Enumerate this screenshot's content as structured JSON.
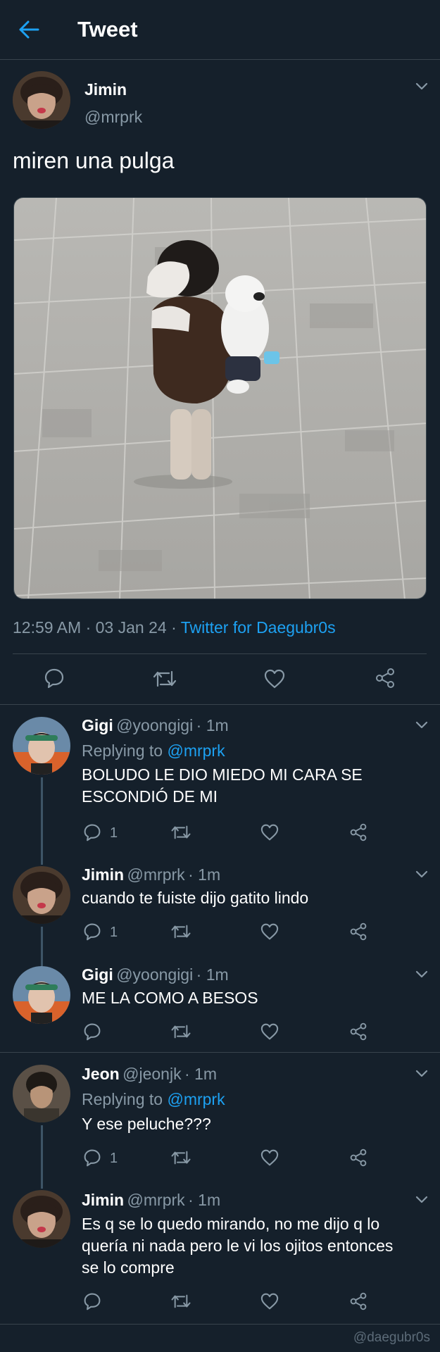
{
  "header": {
    "title": "Tweet"
  },
  "tweet": {
    "name": "Jimin",
    "handle": "@mrprk",
    "text": "miren una pulga",
    "time": "12:59 AM",
    "date": "03 Jan 24",
    "source": "Twitter for Daegubr0s",
    "sep": "·"
  },
  "replies": [
    {
      "name": "Gigi",
      "handle": "@yoongigi",
      "time": "· 1m",
      "replying_label": "Replying to",
      "replying_to": "@mrprk",
      "text_lines": [
        "BOLUDO LE DIO MIEDO MI CARA SE",
        "ESCONDIÓ DE MI"
      ],
      "reply_count": "1"
    },
    {
      "name": "Jimin",
      "handle": "@mrprk",
      "time": "· 1m",
      "text_lines": [
        "cuando te fuiste dijo gatito lindo"
      ],
      "reply_count": "1"
    },
    {
      "name": "Gigi",
      "handle": "@yoongigi",
      "time": "· 1m",
      "text_lines": [
        "ME LA COMO A BESOS"
      ]
    },
    {
      "name": "Jeon",
      "handle": "@jeonjk",
      "time": "· 1m",
      "replying_label": "Replying to",
      "replying_to": "@mrprk",
      "text_lines": [
        "Y ese peluche???"
      ],
      "reply_count": "1"
    },
    {
      "name": "Jimin",
      "handle": "@mrprk",
      "time": "· 1m",
      "text_lines": [
        "Es q se lo quedo mirando, no me dijo q lo",
        "quería ni nada pero le vi los ojitos entonces",
        "se lo compre"
      ]
    }
  ],
  "watermark": "@daegubr0s",
  "colors": {
    "background": "#15202b",
    "accent": "#1da1f2",
    "muted": "#8899a6",
    "divider": "#38444d"
  }
}
